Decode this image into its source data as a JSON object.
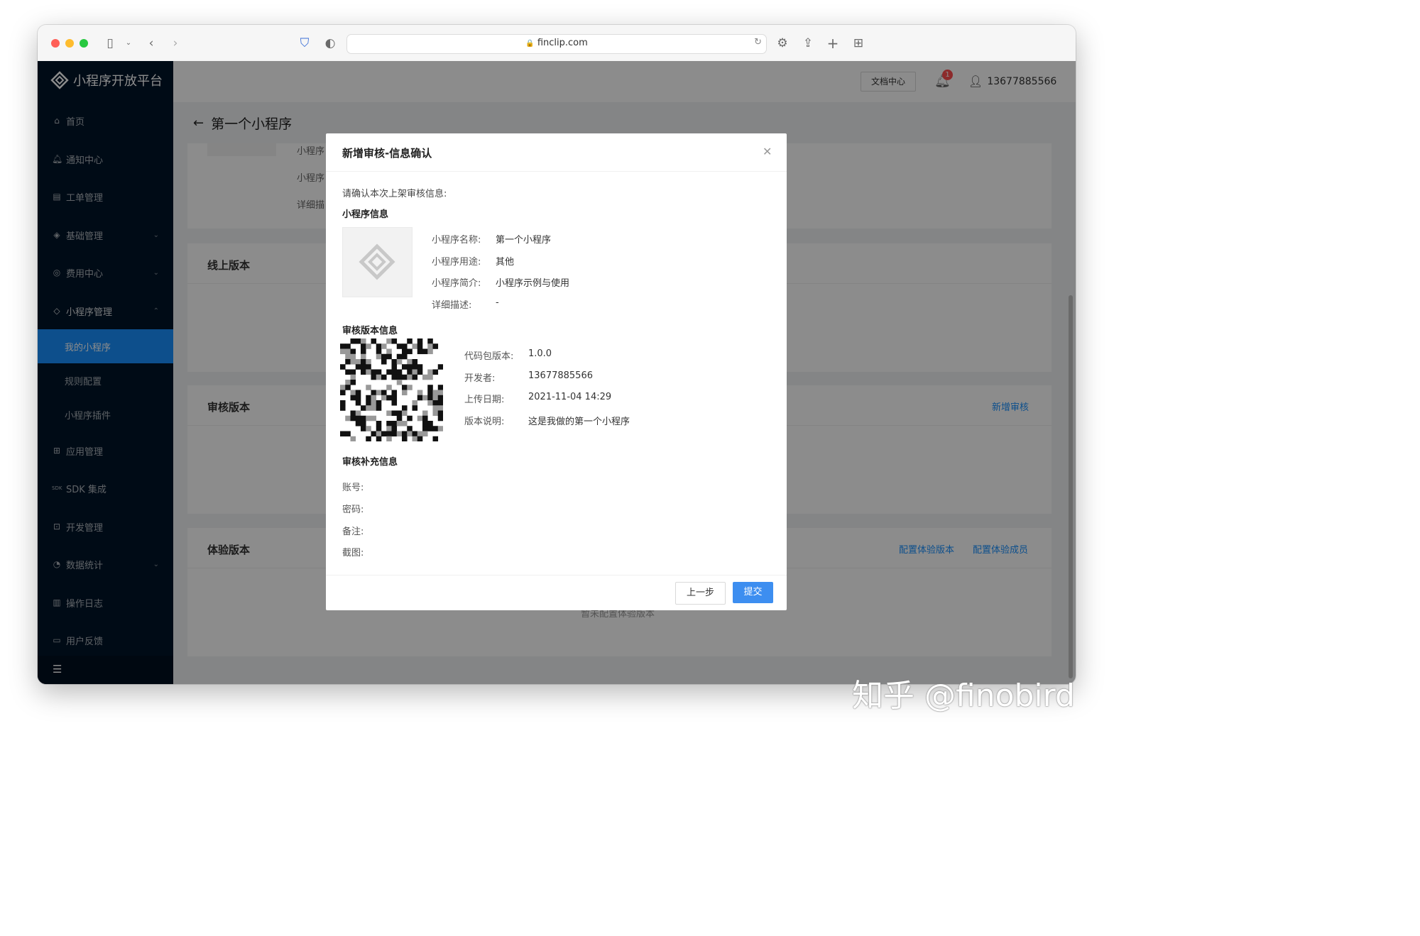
{
  "browser": {
    "url": "finclip.com"
  },
  "sidebar": {
    "logo_text": "小程序开放平台",
    "items": [
      {
        "label": "首页",
        "icon": "home-icon"
      },
      {
        "label": "通知中心",
        "icon": "bell-icon"
      },
      {
        "label": "工单管理",
        "icon": "ticket-icon"
      },
      {
        "label": "基础管理",
        "icon": "layers-icon"
      },
      {
        "label": "费用中心",
        "icon": "coin-icon"
      },
      {
        "label": "小程序管理",
        "icon": "miniapp-icon"
      }
    ],
    "sub_items": [
      {
        "label": "我的小程序",
        "active": true
      },
      {
        "label": "规则配置",
        "active": false
      },
      {
        "label": "小程序插件",
        "active": false
      }
    ],
    "items_after": [
      {
        "label": "应用管理",
        "icon": "grid-icon"
      },
      {
        "label": "SDK 集成",
        "icon": "sdk-icon",
        "icon_text": "SDK"
      },
      {
        "label": "开发管理",
        "icon": "code-icon"
      },
      {
        "label": "数据统计",
        "icon": "chart-icon"
      },
      {
        "label": "操作日志",
        "icon": "log-icon"
      },
      {
        "label": "用户反馈",
        "icon": "feedback-icon"
      }
    ]
  },
  "header": {
    "doc_button": "文档中心",
    "notification_count": "1",
    "user_phone": "13677885566"
  },
  "page": {
    "title": "第一个小程序",
    "info_labels": [
      "小程序",
      "小程序",
      "详细描"
    ],
    "cards": {
      "online": "线上版本",
      "review": "审核版本",
      "review_link": "新增审核",
      "trial": "体验版本",
      "trial_link_1": "配置体验版本",
      "trial_link_2": "配置体验成员",
      "trial_empty": "暂未配置体验版本"
    }
  },
  "modal": {
    "title": "新增审核-信息确认",
    "intro": "请确认本次上架审核信息:",
    "app_section": "小程序信息",
    "app_fields": [
      {
        "label": "小程序名称:",
        "value": "第一个小程序"
      },
      {
        "label": "小程序用途:",
        "value": "其他"
      },
      {
        "label": "小程序简介:",
        "value": "小程序示例与使用"
      },
      {
        "label": "详细描述:",
        "value": "-"
      }
    ],
    "version_section": "审核版本信息",
    "version_fields": [
      {
        "label": "代码包版本:",
        "value": "1.0.0"
      },
      {
        "label": "开发者:",
        "value": "13677885566"
      },
      {
        "label": "上传日期:",
        "value": "2021-11-04 14:29"
      },
      {
        "label": "版本说明:",
        "value": "这是我做的第一个小程序"
      }
    ],
    "extra_section": "审核补充信息",
    "extra_fields": [
      {
        "label": "账号:"
      },
      {
        "label": "密码:"
      },
      {
        "label": "备注:"
      },
      {
        "label": "截图:"
      }
    ],
    "prev_button": "上一步",
    "submit_button": "提交"
  },
  "watermark": "知乎 @finobird",
  "colors": {
    "sidebar": "#001529",
    "accent": "#1890ff",
    "submit": "#3d8ef0"
  }
}
